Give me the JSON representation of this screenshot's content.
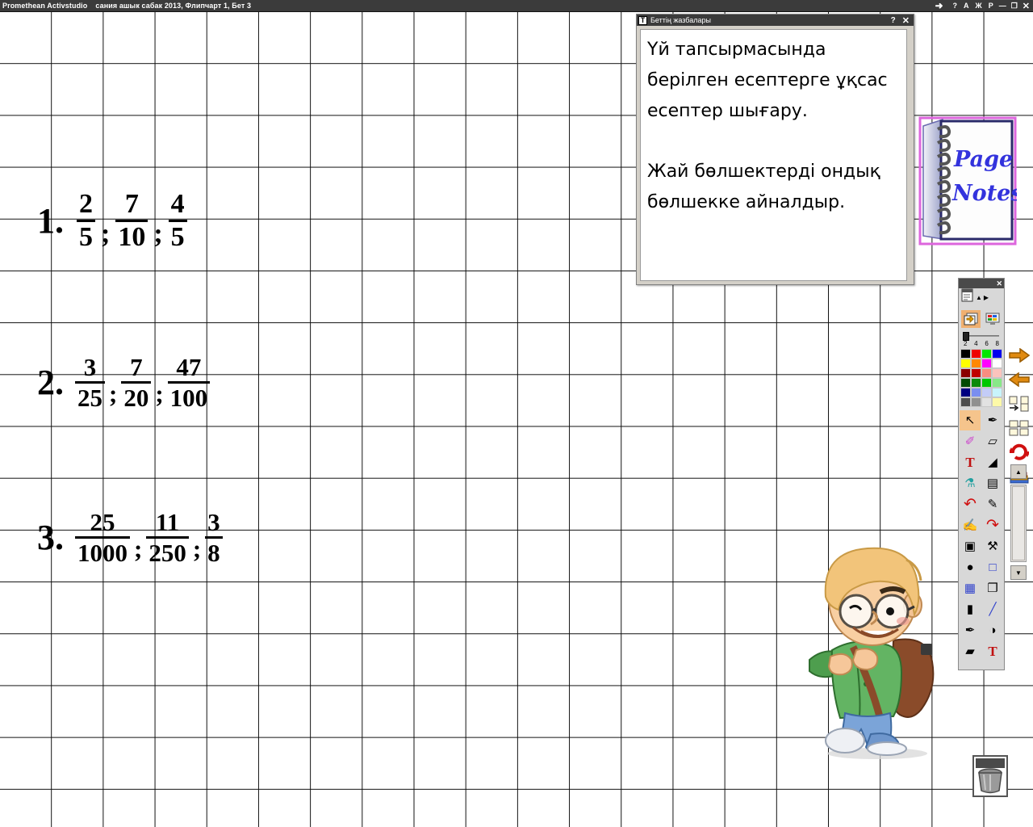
{
  "titlebar": {
    "app_name": "Promethean Activstudio",
    "document": "сания ашык сабак 2013,  Флипчарт 1,  Бет 3",
    "forward_icon": "forward-arrow-icon",
    "help_label": "?",
    "btn_a_label": "А",
    "btn_zh_label": "Ж",
    "btn_r_label": "Р",
    "minimize_label": "—",
    "maximize_label": "❐",
    "close_label": "✕"
  },
  "notes_window": {
    "title": "Беттің жазбалары",
    "icon_label": "T",
    "help_label": "?",
    "close_label": "✕",
    "text": "Үй тапсырмасында берілген есептерге ұқсас есептер шығару.\n\nЖай бөлшектерді ондық бөлшекке айналдыр."
  },
  "notebook": {
    "line1": "Page",
    "line2": "Notes",
    "ink_color": "#3333dd",
    "edge_color": "#dd66dd"
  },
  "exercises": [
    {
      "number": "1.",
      "separator": ";",
      "fractions": [
        {
          "numerator": "2",
          "denominator": "5"
        },
        {
          "numerator": "7",
          "denominator": "10"
        },
        {
          "numerator": "4",
          "denominator": "5"
        }
      ]
    },
    {
      "number": "2.",
      "separator": ";",
      "fractions": [
        {
          "numerator": "3",
          "denominator": "25"
        },
        {
          "numerator": "7",
          "denominator": "20"
        },
        {
          "numerator": "47",
          "denominator": "100"
        }
      ]
    },
    {
      "number": "3.",
      "separator": ";",
      "fractions": [
        {
          "numerator": "25",
          "denominator": "1000"
        },
        {
          "numerator": "11",
          "denominator": "250"
        },
        {
          "numerator": "3",
          "denominator": "8"
        }
      ]
    }
  ],
  "toolbox": {
    "close_label": "✕",
    "doc_icon": "document-icon",
    "up_icon": "▲",
    "next_icon": "▶",
    "mode_pages_icon": "page-flip-icon",
    "mode_desktop_icon": "desktop-icon",
    "width_slider": {
      "value": 2,
      "labels": [
        "2",
        "4",
        "6",
        "8"
      ]
    },
    "palette": [
      [
        "#000000",
        "#ee0000",
        "#00e800",
        "#0000ee"
      ],
      [
        "#ffff00",
        "#ff8800",
        "#ff00ff",
        "#ffffff"
      ],
      [
        "#8b0000",
        "#c00000",
        "#f98d80",
        "#fbc3bd"
      ],
      [
        "#014a01",
        "#0a8a0a",
        "#00c800",
        "#88e888"
      ],
      [
        "#000080",
        "#7a8ef0",
        "#c3ccf7",
        "#c8f4fb"
      ],
      [
        "#4d4d4d",
        "#909090",
        "#e2e2e2",
        "#fdf9a8"
      ]
    ],
    "tools": [
      {
        "name": "select-tool",
        "glyph": "↖",
        "selected": true
      },
      {
        "name": "pen-tool",
        "glyph": "✒",
        "selected": false
      },
      {
        "name": "highlighter-tool",
        "glyph": "✐",
        "selected": false
      },
      {
        "name": "eraser-tool",
        "glyph": "▱",
        "selected": false
      },
      {
        "name": "text-tool",
        "glyph": "T",
        "selected": false
      },
      {
        "name": "fill-tool",
        "glyph": "◢",
        "selected": false
      },
      {
        "name": "spray-tool",
        "glyph": "⚗",
        "selected": false
      },
      {
        "name": "blind-tool",
        "glyph": "▤",
        "selected": false
      },
      {
        "name": "undo-tool",
        "glyph": "↶",
        "selected": false
      },
      {
        "name": "shape-pen-tool",
        "glyph": "✎",
        "selected": false
      },
      {
        "name": "handwriting-tool",
        "glyph": "✍",
        "selected": false
      },
      {
        "name": "redo-tool",
        "glyph": "↷",
        "selected": false
      },
      {
        "name": "camera-tool",
        "glyph": "▣",
        "selected": false
      },
      {
        "name": "settings-tool",
        "glyph": "⚒",
        "selected": false
      },
      {
        "name": "spotlight-tool",
        "glyph": "●",
        "selected": false
      },
      {
        "name": "shape-square-tool",
        "glyph": "□",
        "selected": false
      },
      {
        "name": "grid-tool",
        "glyph": "▦",
        "selected": false
      },
      {
        "name": "copy-tool",
        "glyph": "❐",
        "selected": false
      },
      {
        "name": "save-tool",
        "glyph": "▮",
        "selected": false
      },
      {
        "name": "line-tool",
        "glyph": "╱",
        "selected": false
      },
      {
        "name": "brush-tool",
        "glyph": "✒",
        "selected": false
      },
      {
        "name": "mask-tool",
        "glyph": "◑",
        "selected": false
      },
      {
        "name": "rubber-tool",
        "glyph": "▰",
        "selected": false
      },
      {
        "name": "convert-text-tool",
        "glyph": "T",
        "selected": false
      }
    ]
  },
  "side_actions": [
    {
      "name": "next-page-button",
      "label": "next-page-arrow-icon"
    },
    {
      "name": "previous-page-button",
      "label": "previous-page-arrow-icon"
    },
    {
      "name": "move-page-button",
      "label": "move-page-icon"
    },
    {
      "name": "duplicate-page-button",
      "label": "duplicate-page-icon"
    },
    {
      "name": "reset-page-button",
      "label": "reset-page-icon"
    },
    {
      "name": "resource-library-button",
      "label": "books-icon"
    }
  ],
  "scrollbar": {
    "up_label": "▲",
    "down_label": "▼"
  },
  "trash": {
    "name": "trash-icon"
  }
}
